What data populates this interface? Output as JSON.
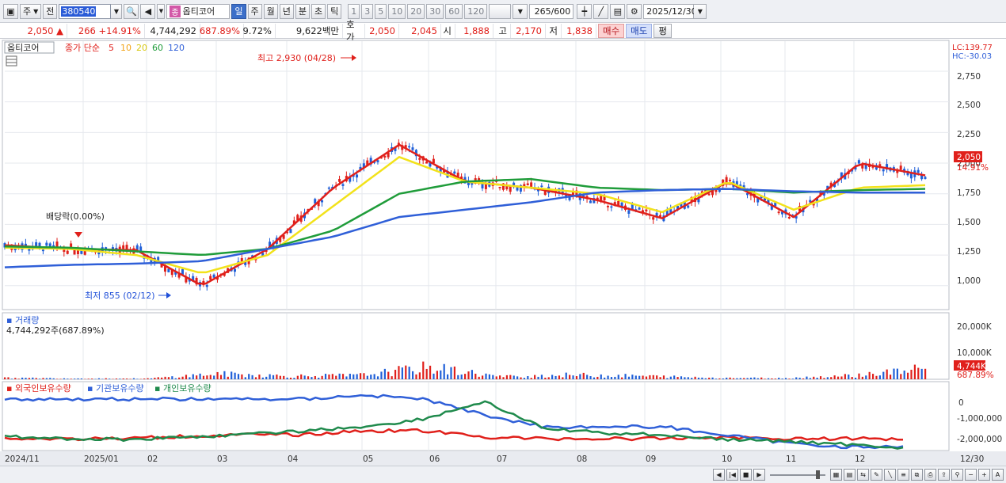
{
  "toolbar": {
    "market": "주",
    "prev_label": "전",
    "code": "380540",
    "stock_name": "옵티코어",
    "stock_badge": "종",
    "periods": [
      "일",
      "주",
      "월",
      "년",
      "분",
      "초",
      "틱"
    ],
    "active_period": "일",
    "intervals": [
      "1",
      "3",
      "5",
      "10",
      "20",
      "30",
      "60",
      "120"
    ],
    "count": "265",
    "count_max": "/600",
    "date": "2025/12/30"
  },
  "quote": {
    "price": "2,050",
    "change_symbol": "▲",
    "change": "266",
    "change_pct": "+14.91%",
    "volume": "4,744,292",
    "volume_ratio": "687.89%",
    "turnover": "9.72%",
    "amount": "9,622백만",
    "hoga_label": "호가",
    "ask": "2,050",
    "bid": "2,045",
    "open_label": "시",
    "open": "1,888",
    "high_label": "고",
    "high": "2,170",
    "low_label": "저",
    "low": "1,838",
    "buy_label": "매수",
    "sell_label": "매도",
    "avg_label": "평"
  },
  "price_panel": {
    "name_tag": "옵티코어",
    "legend_title": "종가 단순",
    "ma_labels": [
      "5",
      "10",
      "20",
      "60",
      "120"
    ],
    "ma_colors": [
      "#e0201b",
      "#f2a316",
      "#f2e21a",
      "#1f9c3a",
      "#2f5fd8"
    ],
    "lc": "LC:139.77",
    "hc": "HC:-30.03",
    "y_ticks": [
      "2,750",
      "2,500",
      "2,250",
      "2,000",
      "1,750",
      "1,500",
      "1,250",
      "1,000"
    ],
    "last_price_tag": "2,050",
    "last_pct_tag": "14.91%",
    "high_annotation": "최고 2,930 (04/28)",
    "low_annotation": "최저 855 (02/12)",
    "dividend_annotation": "배당락(0.00%)"
  },
  "volume_panel": {
    "title": "거래량",
    "subtitle": "4,744,292주(687.89%)",
    "y_ticks": [
      "20,000K",
      "10,000K"
    ],
    "last_tag": "4,744K",
    "last_pct_tag": "687.89%"
  },
  "holdings_panel": {
    "legend": [
      "외국인보유수량",
      "기관보유수량",
      "개인보유수량"
    ],
    "colors": [
      "#e0201b",
      "#2f5fd8",
      "#1f8a4c"
    ],
    "y_ticks": [
      "0",
      "-1,000,000",
      "-2,000,000"
    ]
  },
  "x_axis": {
    "labels": [
      "2024/11",
      "2025/01",
      "02",
      "03",
      "04",
      "05",
      "06",
      "07",
      "08",
      "09",
      "10",
      "11",
      "12",
      "12/30"
    ]
  },
  "colors": {
    "up": "#e0201b",
    "down": "#1f5fd8",
    "panel_bg": "#ffffff",
    "grid": "#e6e8ee"
  },
  "chart_data": {
    "type": "line",
    "title": "",
    "xlabel": "",
    "ylabel": "",
    "ylim": [
      850,
      2950
    ],
    "x": [
      "2024-11",
      "2024-12",
      "2025-01",
      "2025-02",
      "2025-03",
      "2025-04",
      "2025-05",
      "2025-06",
      "2025-07",
      "2025-08",
      "2025-09",
      "2025-10",
      "2025-11",
      "2025-12",
      "2025-12-30"
    ],
    "series": [
      {
        "name": "5",
        "values": [
          1330,
          1300,
          1290,
          1000,
          1300,
          1800,
          2150,
          1850,
          1800,
          1700,
          1550,
          1850,
          1560,
          2000,
          1900
        ]
      },
      {
        "name": "20",
        "values": [
          1310,
          1300,
          1250,
          1100,
          1250,
          1650,
          2050,
          1850,
          1800,
          1750,
          1600,
          1850,
          1620,
          1800,
          1820
        ]
      },
      {
        "name": "60",
        "values": [
          1320,
          1310,
          1280,
          1250,
          1300,
          1450,
          1750,
          1850,
          1870,
          1800,
          1780,
          1790,
          1760,
          1780,
          1790
        ]
      },
      {
        "name": "120",
        "values": [
          1150,
          1170,
          1180,
          1200,
          1300,
          1400,
          1560,
          1620,
          1680,
          1760,
          1780,
          1790,
          1770,
          1760,
          1760
        ]
      }
    ],
    "volume_series": [
      {
        "name": "거래량",
        "values": [
          600,
          400,
          300,
          2500,
          1500,
          1800,
          5500,
          1200,
          2000,
          1500,
          700,
          500,
          1800,
          4744
        ]
      }
    ]
  }
}
